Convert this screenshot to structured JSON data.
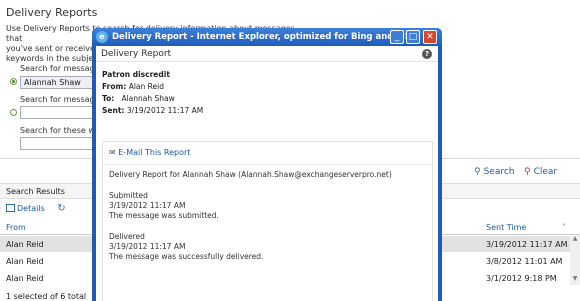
{
  "page": {
    "title": "Delivery Reports",
    "description": [
      "Use Delivery Reports to search for delivery information about messages that",
      "you've sent or received.",
      "keywords in the subject."
    ],
    "search_label_1": "Search for messages",
    "search_value_1": "Alannah Shaw",
    "search_label_2": "Search for messages",
    "search_label_3": "Search for these wor",
    "search_button": "Search",
    "clear_button": "Clear"
  },
  "results": {
    "section_title": "Search Results",
    "details_label": "Details",
    "col_from": "From",
    "col_sent": "Sent Time",
    "rows": [
      {
        "from": "Alan Reid",
        "sent": "3/19/2012 11:17 AM"
      },
      {
        "from": "Alan Reid",
        "sent": "3/8/2012 11:01 AM"
      },
      {
        "from": "Alan Reid",
        "sent": "3/1/2012 9:18 PM"
      }
    ],
    "footer": "1 selected of 6 total"
  },
  "popup": {
    "window_title": "Delivery Report - Internet Explorer, optimized for Bing and MSN",
    "header_title": "Delivery Report",
    "subject": "Patron discredit",
    "from_label": "From:",
    "from_value": "Alan Reid",
    "to_label": "To:",
    "to_value": "Alannah Shaw",
    "sent_label": "Sent:",
    "sent_value": "3/19/2012 11:17 AM",
    "email_link": "E-Mail This Report",
    "report_heading": "Delivery Report for  Alannah Shaw (Alannah.Shaw@exchangeserverpro.net)",
    "submitted_label": "Submitted",
    "submitted_time": "3/19/2012 11:17 AM",
    "submitted_msg": "The message was submitted.",
    "delivered_label": "Delivered",
    "delivered_time": "3/19/2012 11:17 AM",
    "delivered_msg": "The message was successfully delivered."
  },
  "colors": {
    "titlebar": "#1f5cb9",
    "link": "#1a5a9a",
    "selected_row": "#e2e2e2"
  }
}
